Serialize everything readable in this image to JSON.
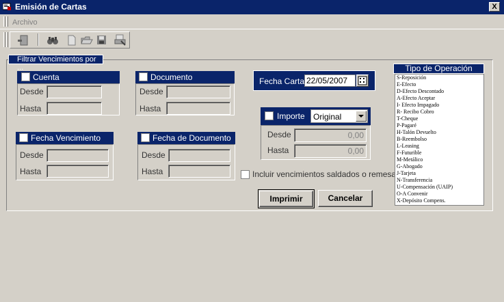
{
  "window": {
    "title": "Emisión de Cartas",
    "close_label": "X"
  },
  "menu": {
    "archivo": "Archivo"
  },
  "toolbar": {
    "buttons": [
      "exit-icon",
      "binoculars-icon",
      "new-document-icon",
      "open-folder-icon",
      "save-icon",
      "print-setup-icon"
    ]
  },
  "filter": {
    "title": "Filtrar Vencimientos por ...",
    "cuenta": {
      "label": "Cuenta",
      "desde": "Desde",
      "hasta": "Hasta"
    },
    "documento": {
      "label": "Documento",
      "desde": "Desde",
      "hasta": "Hasta"
    },
    "fecha_vencimiento": {
      "label": "Fecha Vencimiento",
      "desde": "Desde",
      "hasta": "Hasta"
    },
    "fecha_documento": {
      "label": "Fecha de Documento",
      "desde": "Desde",
      "hasta": "Hasta"
    },
    "fecha_carta": {
      "label": "Fecha Carta",
      "value": "22/05/2007"
    },
    "importe": {
      "label": "Importe",
      "select_value": "Original",
      "desde_label": "Desde",
      "desde_value": "0,00",
      "hasta_label": "Hasta",
      "hasta_value": "0,00"
    },
    "incluir_label": "Incluir vencimientos saldados o remesados"
  },
  "buttons": {
    "imprimir": "Imprimir",
    "cancelar": "Cancelar"
  },
  "tipo_operacion": {
    "title": "Tipo de Operación",
    "items": [
      "S-Reposición",
      "E-Efecto",
      "D-Efecto Descontado",
      "A-Efecto Aceptar",
      "I- Efecto Impagado",
      "R- Recibo Cobro",
      "T-Cheque",
      "P-Pagaré",
      "H-Talón Devuelto",
      "B-Reembolso",
      "L-Leasing",
      "F-Futurible",
      "M-Metálico",
      "G-Abogado",
      "J-Tarjeta",
      "N-Transferencia",
      "U-Compensación (UAIP)",
      "O-A Convenir",
      "X-Depósito Compens."
    ]
  },
  "colors": {
    "title_bar": "#0a246a",
    "face": "#d4d0c8"
  }
}
